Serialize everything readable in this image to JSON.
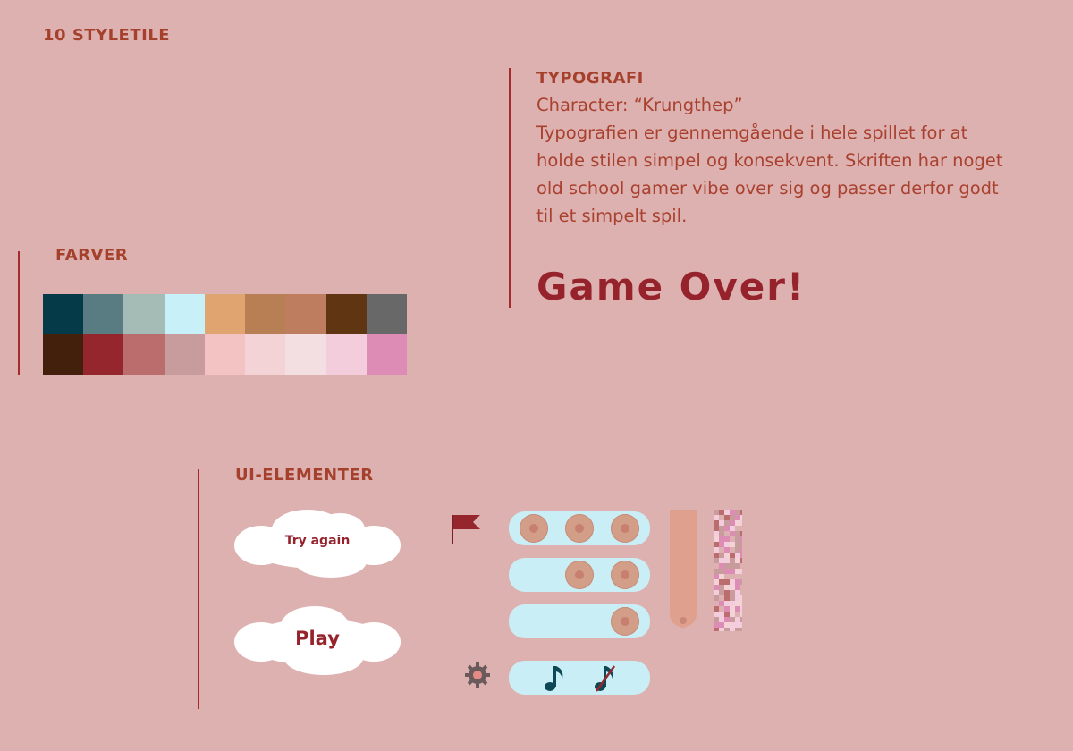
{
  "page_title": "10 STYLETILE",
  "typography": {
    "heading": "TYPOGRAFI",
    "character": "Character: “Krungthep”",
    "body": "Typografien er gennemgående i hele spillet for at holde stilen simpel og konsekvent. Skriften har noget old school gamer vibe over sig og passer derfor godt til et simpelt spil.",
    "sample": "Game Over!"
  },
  "colors": {
    "heading": "FARVER",
    "swatches_row1": [
      "#053b49",
      "#597b82",
      "#a5bbb5",
      "#c8f0f8",
      "#dfa46f",
      "#b77f53",
      "#bf7d5f",
      "#5f3512",
      "#686868"
    ],
    "swatches_row2": [
      "#42200c",
      "#96262d",
      "#bb6d6d",
      "#c89c9c",
      "#f3c3c3",
      "#f4d3d7",
      "#f3dee2",
      "#f3cddb",
      "#dd8cb6"
    ]
  },
  "ui_elements": {
    "heading": "UI-ELEMENTER",
    "try_again_label": "Try again",
    "play_label": "Play",
    "music_on_icon": "music-note-icon",
    "music_off_icon": "music-note-muted-icon",
    "settings_icon": "gear-icon",
    "flag_icon": "flag-icon",
    "lives": [
      3,
      2,
      1
    ]
  }
}
